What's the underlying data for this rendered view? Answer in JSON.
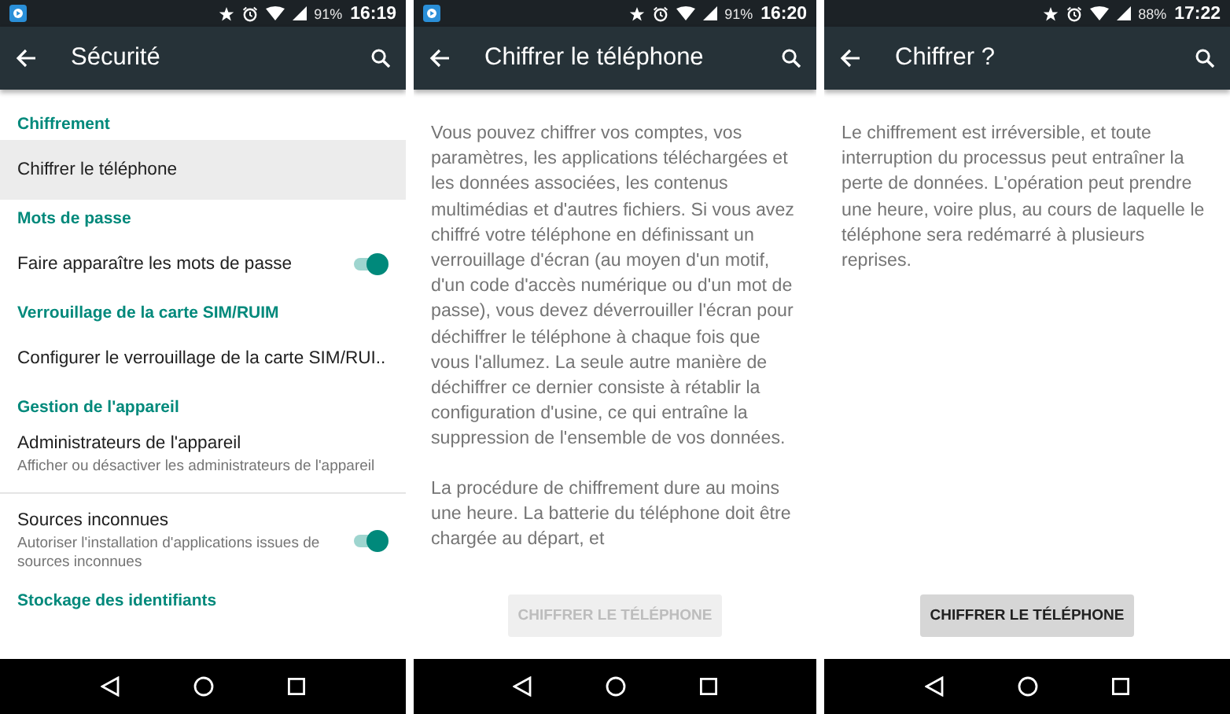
{
  "screens": [
    {
      "kind": "settings",
      "status_bar": {
        "notification_icon": true,
        "battery": "91%",
        "time": "16:19"
      },
      "app_bar": {
        "title": "Sécurité"
      },
      "items": [
        {
          "kind": "header",
          "title": "Chiffrement"
        },
        {
          "kind": "item",
          "title": "Chiffrer le téléphone",
          "pressed": true
        },
        {
          "kind": "header",
          "title": "Mots de passe"
        },
        {
          "kind": "toggle",
          "title": "Faire apparaître les mots de passe",
          "on": true
        },
        {
          "kind": "header",
          "title": "Verrouillage de la carte SIM/RUIM"
        },
        {
          "kind": "item",
          "title": "Configurer le verrouillage de la carte SIM/RUI..",
          "pressed": false
        },
        {
          "kind": "header",
          "title": "Gestion de l'appareil"
        },
        {
          "kind": "item",
          "title": "Administrateurs de l'appareil",
          "subtitle": "Afficher ou désactiver les administrateurs de l'appareil",
          "pressed": false
        },
        {
          "kind": "divider"
        },
        {
          "kind": "toggle",
          "title": "Sources inconnues",
          "subtitle": "Autoriser l'installation d'applications issues de sources inconnues",
          "on": true
        },
        {
          "kind": "header",
          "title": "Stockage des identifiants"
        }
      ]
    },
    {
      "kind": "text",
      "status_bar": {
        "notification_icon": true,
        "battery": "91%",
        "time": "16:20"
      },
      "app_bar": {
        "title": "Chiffrer le téléphone"
      },
      "paragraphs": [
        "Vous pouvez chiffrer vos comptes, vos paramètres, les applications téléchargées et les données associées, les contenus multimédias et d'autres fichiers. Si vous avez chiffré votre téléphone en définissant un verrouillage d'écran (au moyen d'un motif, d'un code d'accès numérique ou d'un mot de passe), vous devez déverrouiller l'écran pour déchiffrer le téléphone à chaque fois que vous l'allumez. La seule autre manière de déchiffrer ce dernier consiste à rétablir la configuration d'usine, ce qui entraîne la suppression de l'ensemble de vos données.",
        "La procédure de chiffrement dure au moins une heure. La batterie du téléphone doit être chargée au départ, et"
      ],
      "button": {
        "label": "CHIFFRER LE TÉLÉPHONE",
        "disabled": true
      }
    },
    {
      "kind": "text",
      "status_bar": {
        "notification_icon": false,
        "battery": "88%",
        "time": "17:22"
      },
      "app_bar": {
        "title": "Chiffrer ?"
      },
      "paragraphs": [
        "Le chiffrement est irréversible, et toute interruption du processus peut entraîner la perte de données. L'opération peut prendre une heure, voire plus, au cours de laquelle le téléphone sera redémarré à plusieurs reprises."
      ],
      "button": {
        "label": "CHIFFRER LE TÉLÉPHONE",
        "disabled": false
      }
    }
  ]
}
